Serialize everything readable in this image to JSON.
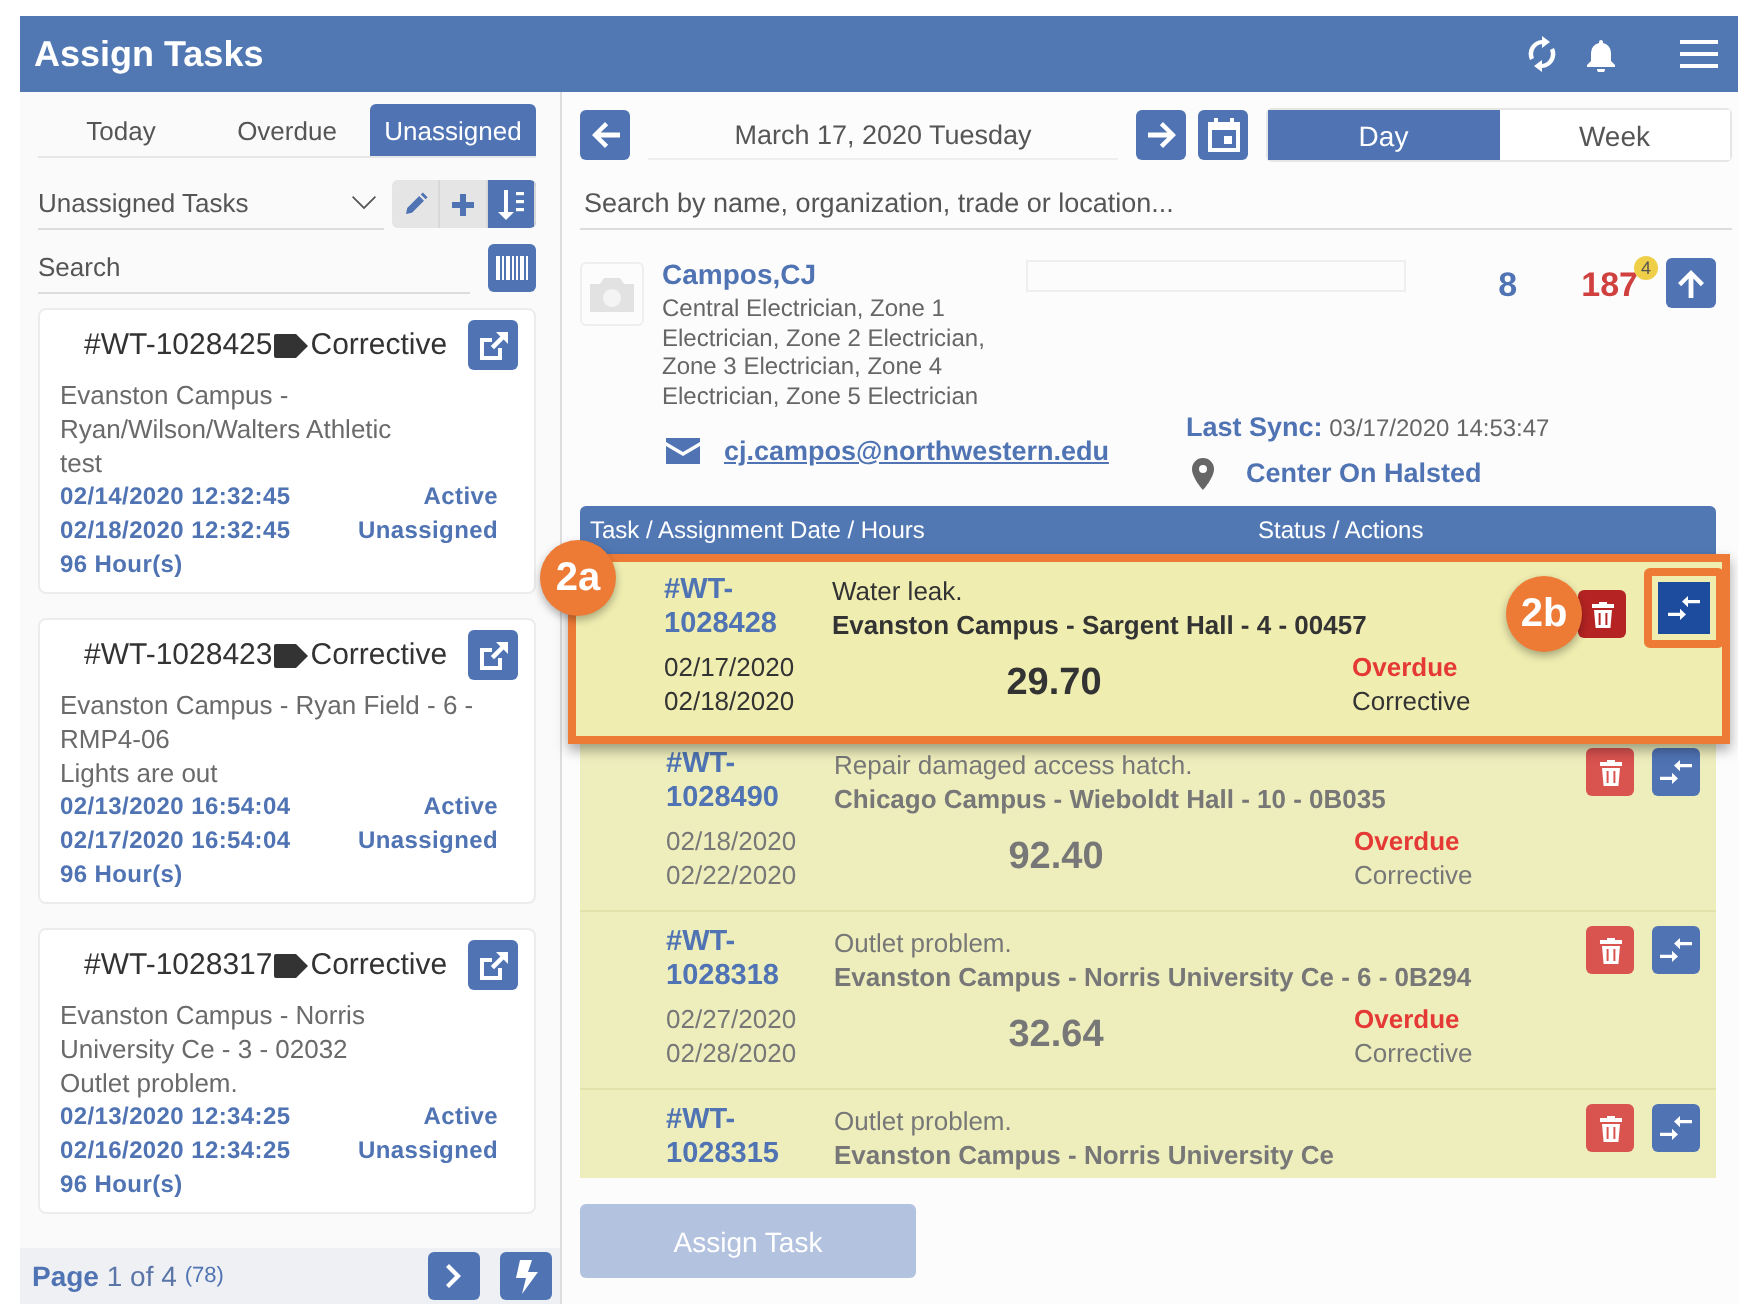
{
  "header": {
    "title": "Assign Tasks"
  },
  "left": {
    "tabs": [
      {
        "label": "Today",
        "selected": false
      },
      {
        "label": "Overdue",
        "selected": false
      },
      {
        "label": "Unassigned",
        "selected": true
      }
    ],
    "filter": {
      "value": "Unassigned Tasks"
    },
    "search": {
      "placeholder": "Search"
    },
    "cards": [
      {
        "id": "#WT-1028425",
        "type": "Corrective",
        "location": "Evanston Campus - Ryan/Wilson/Walters Athletic",
        "description": "test",
        "start": "02/14/2020 12:32:45",
        "end": "02/18/2020 12:32:45",
        "status": "Active",
        "assignment": "Unassigned",
        "hours": "96 Hour(s)"
      },
      {
        "id": "#WT-1028423",
        "type": "Corrective",
        "location": "Evanston Campus - Ryan Field - 6 - RMP4-06",
        "description": "Lights are out",
        "start": "02/13/2020 16:54:04",
        "end": "02/17/2020 16:54:04",
        "status": "Active",
        "assignment": "Unassigned",
        "hours": "96 Hour(s)"
      },
      {
        "id": "#WT-1028317",
        "type": "Corrective",
        "location": "Evanston Campus - Norris University Ce - 3 - 02032",
        "description": "Outlet problem.",
        "start": "02/13/2020 12:34:25",
        "end": "02/16/2020 12:34:25",
        "status": "Active",
        "assignment": "Unassigned",
        "hours": "96 Hour(s)"
      }
    ],
    "pager": {
      "text": "**Page** 1 of 4",
      "count": "(78)"
    }
  },
  "right": {
    "date": "March 17, 2020 Tuesday",
    "views": [
      {
        "label": "Day",
        "selected": true
      },
      {
        "label": "Week",
        "selected": false
      }
    ],
    "search": {
      "placeholder": "Search by name, organization, trade or location..."
    },
    "person": {
      "name": "Campos,CJ",
      "trades": "Central Electrician, Zone 1 Electrician, Zone 2 Electrician, Zone 3 Electrician, Zone 4 Electrician, Zone 5 Electrician",
      "email": "cj.campos@northwestern.edu",
      "count": "8",
      "hours": "187",
      "hours_badge": "4",
      "last_sync_label": "Last Sync:",
      "last_sync": "03/17/2020 14:53:47",
      "location": "Center On Halsted"
    },
    "table": {
      "columns": [
        "Task / Assignment Date / Hours",
        "Status / Actions"
      ],
      "rows": [
        {
          "id": "#WT-1028428",
          "description": "Water leak.",
          "location": "Evanston Campus - Sargent Hall - 4 - 00457",
          "start": "02/17/2020",
          "end": "02/18/2020",
          "hours": "29.70",
          "status": "Overdue",
          "type": "Corrective",
          "highlighted": true,
          "callout": "2a",
          "action_callout": "2b"
        },
        {
          "id": "#WT-1028490",
          "description": "Repair damaged access hatch.",
          "location": "Chicago Campus - Wieboldt Hall - 10 - 0B035",
          "start": "02/18/2020",
          "end": "02/22/2020",
          "hours": "92.40",
          "status": "Overdue",
          "type": "Corrective",
          "highlighted": false
        },
        {
          "id": "#WT-1028318",
          "description": "Outlet problem.",
          "location": "Evanston Campus - Norris University Ce - 6 - 0B294",
          "start": "02/27/2020",
          "end": "02/28/2020",
          "hours": "32.64",
          "status": "Overdue",
          "type": "Corrective",
          "highlighted": false
        },
        {
          "id": "#WT-1028315",
          "description": "Outlet problem.",
          "location": "Evanston Campus - Norris University Ce",
          "highlighted": false
        }
      ]
    },
    "assign_button": {
      "label": "Assign Task",
      "disabled": true
    }
  }
}
